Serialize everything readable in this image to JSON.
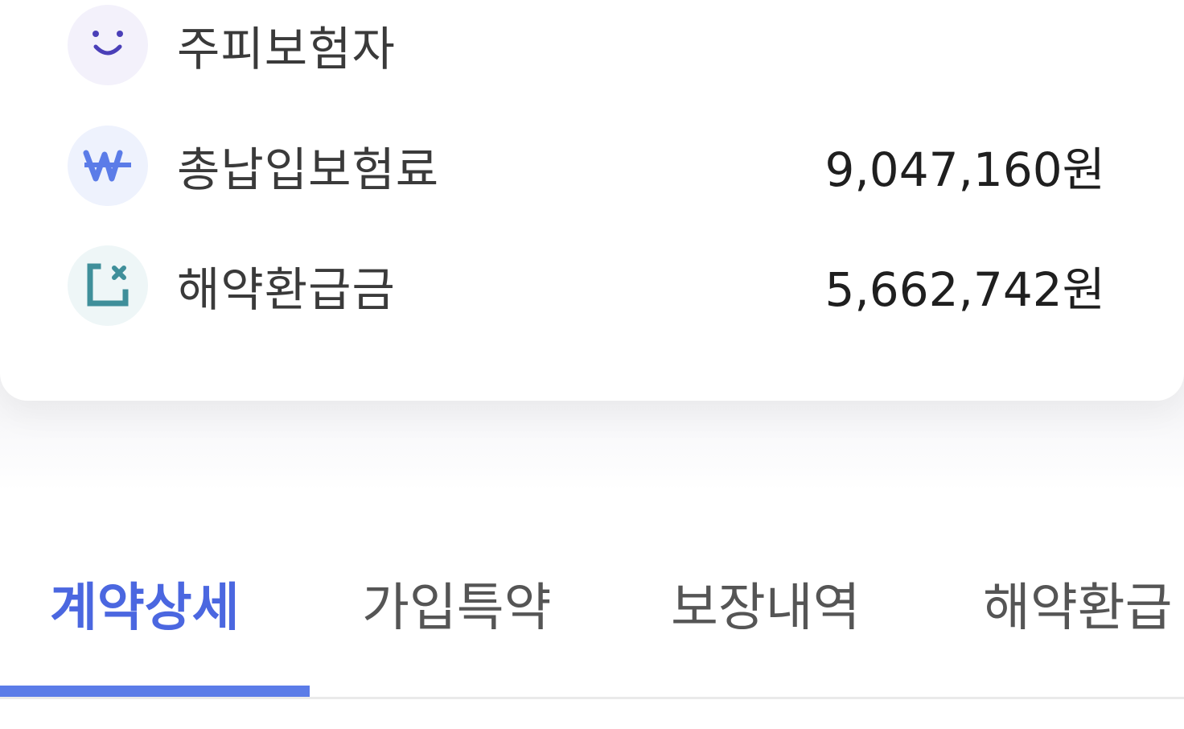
{
  "summary": {
    "rows": [
      {
        "label": "주피보험자",
        "value": "",
        "icon": "smile-icon",
        "icon_color": "#4a3fb8"
      },
      {
        "label": "총납입보험료",
        "value": "9,047,160원",
        "icon": "won-icon",
        "icon_color": "#5b7ce8"
      },
      {
        "label": "해약환급금",
        "value": "5,662,742원",
        "icon": "refund-icon",
        "icon_color": "#3f8f9a"
      }
    ]
  },
  "tabs": {
    "items": [
      {
        "label": "계약상세",
        "active": true
      },
      {
        "label": "가입특약",
        "active": false
      },
      {
        "label": "보장내역",
        "active": false
      },
      {
        "label": "해약환급"
      }
    ],
    "active_color": "#4b67e0",
    "indicator_color": "#5b7ce8"
  }
}
